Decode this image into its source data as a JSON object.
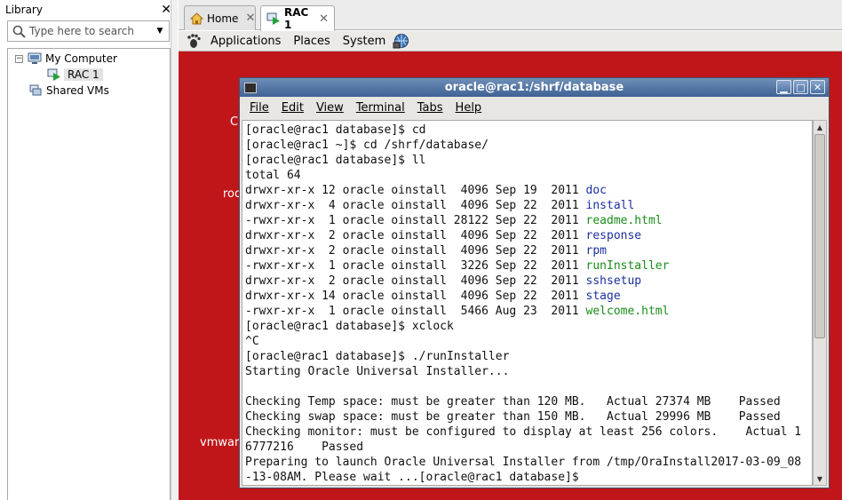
{
  "library": {
    "title": "Library",
    "close_glyph": "✕",
    "search": {
      "placeholder": "Type here to search"
    },
    "tree": {
      "my_computer": "My Computer",
      "rac1": "RAC 1",
      "shared_vms": "Shared VMs",
      "toggle": "−"
    }
  },
  "tabs": [
    {
      "label": "Home",
      "close": "✕"
    },
    {
      "label": "RAC 1",
      "close": "✕"
    }
  ],
  "gnome_panel": {
    "applications": "Applications",
    "places": "Places",
    "system": "System"
  },
  "desktop": {
    "frag1": "C",
    "frag2": "roo",
    "frag3": "vmwar"
  },
  "terminal": {
    "title": "oracle@rac1:/shrf/database",
    "menu": [
      "File",
      "Edit",
      "View",
      "Terminal",
      "Tabs",
      "Help"
    ],
    "lines": [
      "[oracle@rac1 database]$ cd",
      "[oracle@rac1 ~]$ cd /shrf/database/",
      "[oracle@rac1 database]$ ll",
      "total 64",
      "drwxr-xr-x 12 oracle oinstall  4096 Sep 19  2011 ",
      "drwxr-xr-x  4 oracle oinstall  4096 Sep 22  2011 ",
      "-rwxr-xr-x  1 oracle oinstall 28122 Sep 22  2011 ",
      "drwxr-xr-x  2 oracle oinstall  4096 Sep 22  2011 ",
      "drwxr-xr-x  2 oracle oinstall  4096 Sep 22  2011 ",
      "-rwxr-xr-x  1 oracle oinstall  3226 Sep 22  2011 ",
      "drwxr-xr-x  2 oracle oinstall  4096 Sep 22  2011 ",
      "drwxr-xr-x 14 oracle oinstall  4096 Sep 22  2011 ",
      "-rwxr-xr-x  1 oracle oinstall  5466 Aug 23  2011 ",
      "[oracle@rac1 database]$ xclock",
      "^C",
      "[oracle@rac1 database]$ ./runInstaller",
      "Starting Oracle Universal Installer...",
      "",
      "Checking Temp space: must be greater than 120 MB.   Actual 27374 MB    Passed",
      "Checking swap space: must be greater than 150 MB.   Actual 29996 MB    Passed",
      "Checking monitor: must be configured to display at least 256 colors.    Actual 1",
      "6777216    Passed",
      "Preparing to launch Oracle Universal Installer from /tmp/OraInstall2017-03-09_08",
      "-13-08AM. Please wait ...[oracle@rac1 database]$ "
    ],
    "files": [
      "doc",
      "install",
      "readme.html",
      "response",
      "rpm",
      "runInstaller",
      "sshsetup",
      "stage",
      "welcome.html"
    ]
  },
  "colors": {
    "desktop_red": "#c0161a",
    "dir_blue": "#1c2fa0",
    "exec_green": "#1a8d1a",
    "titlebar_blue": "#3e6294"
  }
}
